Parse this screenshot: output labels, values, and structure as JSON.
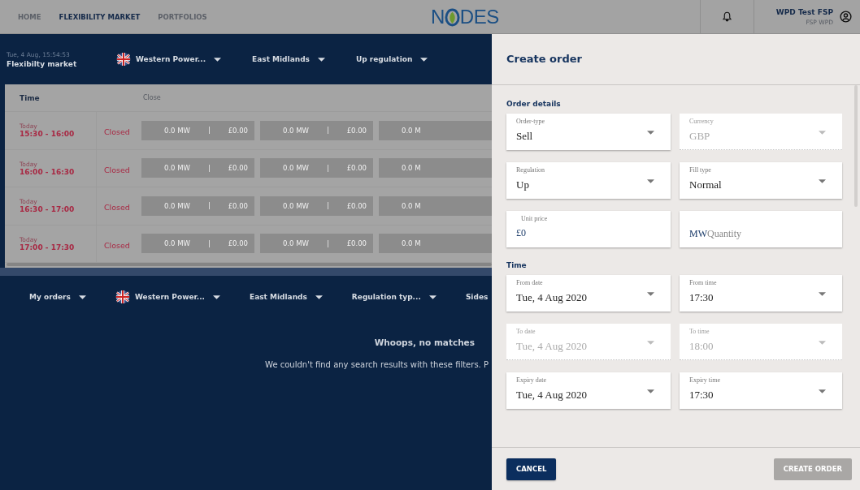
{
  "top_nav": {
    "items": [
      {
        "label": "HOME",
        "selected": false
      },
      {
        "label": "FLEXIBILITY MARKET",
        "selected": true
      },
      {
        "label": "PORTFOLIOS",
        "selected": false
      }
    ],
    "logo": {
      "left": "N",
      "right": "DES"
    },
    "user": {
      "name": "WPD Test FSP",
      "org": "FSP WPD"
    }
  },
  "market_bar": {
    "timestamp": "Tue, 4 Aug, 15:54:53",
    "title": "Flexibilty market",
    "filters": [
      {
        "label": "Western Power...",
        "flag": true
      },
      {
        "label": "East Midlands",
        "flag": false
      },
      {
        "label": "Up regulation",
        "flag": false
      }
    ]
  },
  "table": {
    "columns": [
      "Time",
      "Close"
    ],
    "rows": [
      {
        "day": "Today",
        "time": "15:30 - 16:00",
        "status": "Closed",
        "cells": [
          {
            "mw": "0.0 MW",
            "price": "£0.00"
          },
          {
            "mw": "0.0 MW",
            "price": "£0.00"
          },
          {
            "mw": "0.0 M"
          }
        ]
      },
      {
        "day": "Today",
        "time": "16:00 - 16:30",
        "status": "Closed",
        "cells": [
          {
            "mw": "0.0 MW",
            "price": "£0.00"
          },
          {
            "mw": "0.0 MW",
            "price": "£0.00"
          },
          {
            "mw": "0.0 M"
          }
        ]
      },
      {
        "day": "Today",
        "time": "16:30 - 17:00",
        "status": "Closed",
        "cells": [
          {
            "mw": "0.0 MW",
            "price": "£0.00"
          },
          {
            "mw": "0.0 MW",
            "price": "£0.00"
          },
          {
            "mw": "0.0 M"
          }
        ]
      },
      {
        "day": "Today",
        "time": "17:00 - 17:30",
        "status": "Closed",
        "cells": [
          {
            "mw": "0.0 MW",
            "price": "£0.00"
          },
          {
            "mw": "0.0 MW",
            "price": "£0.00"
          },
          {
            "mw": "0.0 M"
          }
        ]
      }
    ]
  },
  "orders_bar": {
    "filters": [
      {
        "label": "My orders",
        "flag": false
      },
      {
        "label": "Western Power...",
        "flag": true
      },
      {
        "label": "East Midlands",
        "flag": false
      },
      {
        "label": "Regulation typ...",
        "flag": false
      },
      {
        "label": "Sides",
        "flag": false
      }
    ]
  },
  "empty_state": {
    "title": "Whoops, no matches",
    "message": "We couldn't find any search results with these filters. P"
  },
  "drawer": {
    "title": "Create order",
    "sections": [
      {
        "title": "Order details",
        "fields": [
          {
            "kind": "select",
            "label": "Order-type",
            "value": "Sell",
            "disabled": false
          },
          {
            "kind": "select",
            "label": "Currency",
            "value": "GBP",
            "disabled": true
          },
          {
            "kind": "select",
            "label": "Regulation",
            "value": "Up",
            "disabled": false
          },
          {
            "kind": "select",
            "label": "Fill type",
            "value": "Normal",
            "disabled": false
          },
          {
            "kind": "input",
            "label": "Unit price",
            "value": "£0",
            "disabled": false
          },
          {
            "kind": "prefixed",
            "prefix": "MW",
            "placeholder": "Quantity",
            "disabled": false
          }
        ]
      },
      {
        "title": "Time",
        "fields": [
          {
            "kind": "select",
            "label": "From date",
            "value": "Tue, 4 Aug 2020",
            "disabled": false
          },
          {
            "kind": "select",
            "label": "From time",
            "value": "17:30",
            "disabled": false
          },
          {
            "kind": "select",
            "label": "To date",
            "value": "Tue, 4 Aug 2020",
            "disabled": true
          },
          {
            "kind": "select",
            "label": "To time",
            "value": "18:00",
            "disabled": true
          },
          {
            "kind": "select",
            "label": "Expiry date",
            "value": "Tue, 4 Aug 2020",
            "disabled": false
          },
          {
            "kind": "select",
            "label": "Expiry time",
            "value": "17:30",
            "disabled": false
          }
        ]
      }
    ],
    "buttons": [
      {
        "label": "CANCEL",
        "disabled": false
      },
      {
        "label": "CREATE ORDER",
        "disabled": true
      }
    ]
  }
}
